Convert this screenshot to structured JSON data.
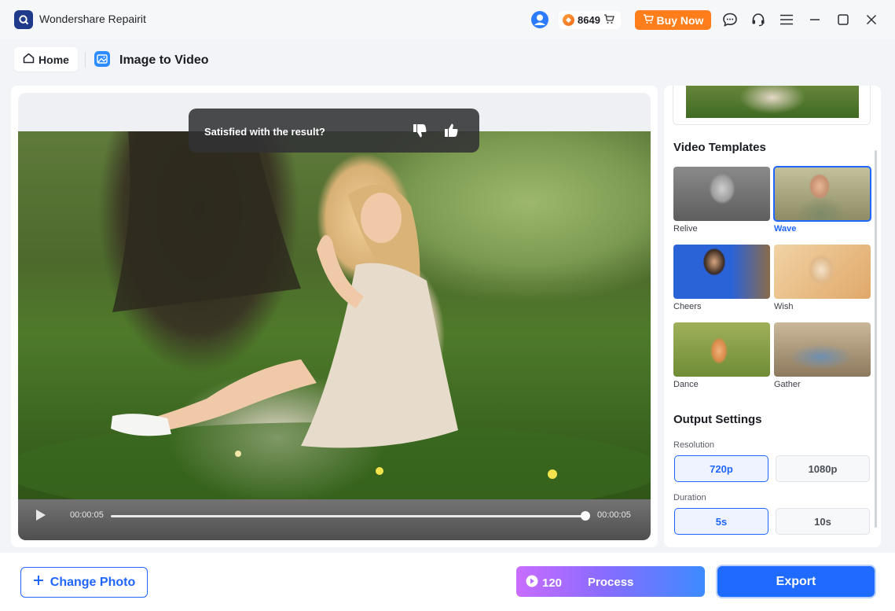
{
  "titlebar": {
    "app_title": "Wondershare Repairit",
    "credits": "8649",
    "buy_now": "Buy Now",
    "icons": [
      "user-avatar-icon",
      "chat-icon",
      "headset-icon",
      "menu-icon",
      "minimize-icon",
      "maximize-icon",
      "close-icon"
    ]
  },
  "nav": {
    "home": "Home",
    "page_title": "Image to Video"
  },
  "preview": {
    "feedback_prompt": "Satisfied with the result?",
    "current_time": "00:00:05",
    "total_time": "00:00:05",
    "progress": 1.0
  },
  "side": {
    "templates_title": "Video Templates",
    "templates": [
      {
        "label": "Relive",
        "selected": false
      },
      {
        "label": "Wave",
        "selected": true
      },
      {
        "label": "Cheers",
        "selected": false
      },
      {
        "label": "Wish",
        "selected": false
      },
      {
        "label": "Dance",
        "selected": false
      },
      {
        "label": "Gather",
        "selected": false
      }
    ],
    "output_title": "Output Settings",
    "resolution_label": "Resolution",
    "resolution_options": [
      "720p",
      "1080p"
    ],
    "resolution_selected": "720p",
    "duration_label": "Duration",
    "duration_options": [
      "5s",
      "10s"
    ],
    "duration_selected": "5s"
  },
  "bottom": {
    "change_photo": "Change Photo",
    "process_cost": "120",
    "process": "Process",
    "export": "Export"
  },
  "colors": {
    "accent": "#1f66ff",
    "buy_now": "#ff7d1a"
  }
}
